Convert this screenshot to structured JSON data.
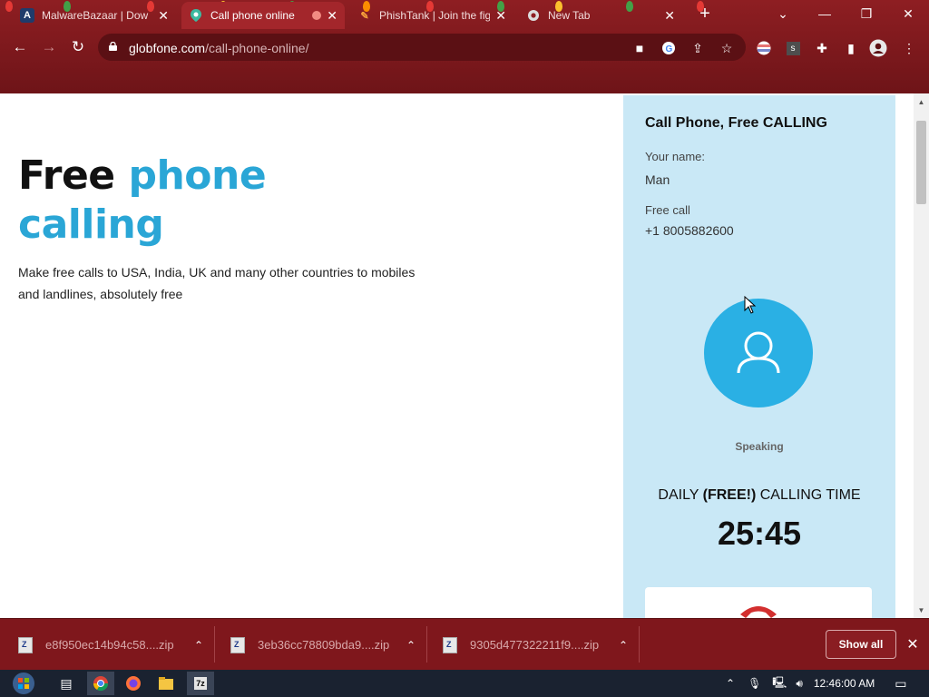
{
  "browser": {
    "tabs": [
      {
        "title": "MalwareBazaar | Dow",
        "icon": "malwarebazaar-icon",
        "active": false
      },
      {
        "title": "Call phone online",
        "icon": "globfone-icon",
        "active": true
      },
      {
        "title": "PhishTank | Join the fig",
        "icon": "phishtank-icon",
        "active": false
      },
      {
        "title": "New Tab",
        "icon": "chrome-icon",
        "active": false
      }
    ],
    "url_host": "globfone.com",
    "url_path": "/call-phone-online/"
  },
  "hero": {
    "title_part1": "Free ",
    "title_part2": "phone",
    "title_part3": "calling",
    "subtitle": "Make free calls to USA, India, UK and many other countries to mobiles and landlines, absolutely free"
  },
  "panel": {
    "title": "Call Phone, Free CALLING",
    "name_label": "Your name:",
    "name_value": "Man",
    "call_label": "Free call",
    "call_number": "+1 8005882600",
    "status": "Speaking",
    "daily_prefix": "DAILY ",
    "daily_bold": "(FREE!)",
    "daily_suffix": " CALLING TIME",
    "timer": "25:45"
  },
  "downloads": {
    "items": [
      "e8f950ec14b94c58....zip",
      "3eb36cc78809bda9....zip",
      "9305d477322211f9....zip"
    ],
    "show_all": "Show all"
  },
  "taskbar": {
    "time": "12:46:00 AM"
  },
  "colors": {
    "chrome": "#8e1e22",
    "accent_blue": "#2aa6d6",
    "panel_bg": "#c9e8f6",
    "avatar": "#2ab0e4"
  }
}
